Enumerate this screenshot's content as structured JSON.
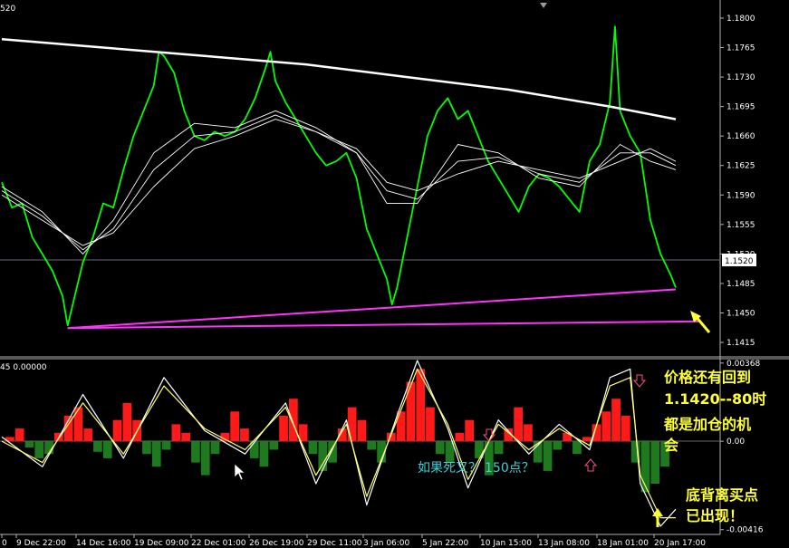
{
  "chart_data": [
    {
      "type": "line",
      "panel": "price",
      "symbol_fragment": "520",
      "y_ticks": [
        "1.1800",
        "1.1765",
        "1.1730",
        "1.1695",
        "1.1660",
        "1.1625",
        "1.1590",
        "1.1555",
        "1.1520",
        "1.1485",
        "1.1450",
        "1.1415"
      ],
      "ylim": [
        1.14,
        1.1815
      ],
      "current_price_label": "1.1520",
      "x_ticks": [
        "0",
        "9 Dec 22:00",
        "14 Dec 16:00",
        "19 Dec 09:00",
        "22 Dec 01:00",
        "26 Dec 19:00",
        "29 Dec 11:00",
        "3 Jan 06:00",
        "5 Jan 22:00",
        "10 Jan 15:00",
        "13 Jan 08:00",
        "18 Jan 01:00",
        "20 Jan 17:00"
      ],
      "series": [
        {
          "color": "#00ff00",
          "points": [
            [
              0,
              1.1605
            ],
            [
              2,
              1.1575
            ],
            [
              4,
              1.158
            ],
            [
              6,
              1.154
            ],
            [
              8,
              1.152
            ],
            [
              10,
              1.15
            ],
            [
              12,
              1.147
            ],
            [
              13,
              1.1435
            ],
            [
              14,
              1.146
            ],
            [
              16,
              1.151
            ],
            [
              18,
              1.154
            ],
            [
              20,
              1.158
            ],
            [
              22,
              1.1575
            ],
            [
              24,
              1.162
            ],
            [
              26,
              1.166
            ],
            [
              28,
              1.169
            ],
            [
              30,
              1.172
            ],
            [
              31,
              1.176
            ],
            [
              32,
              1.1755
            ],
            [
              34,
              1.1735
            ],
            [
              36,
              1.169
            ],
            [
              38,
              1.166
            ],
            [
              40,
              1.1655
            ],
            [
              42,
              1.1665
            ],
            [
              44,
              1.166
            ],
            [
              46,
              1.1665
            ],
            [
              48,
              1.168
            ],
            [
              50,
              1.1705
            ],
            [
              52,
              1.174
            ],
            [
              53,
              1.176
            ],
            [
              54,
              1.1725
            ],
            [
              56,
              1.17
            ],
            [
              58,
              1.168
            ],
            [
              60,
              1.166
            ],
            [
              62,
              1.164
            ],
            [
              64,
              1.1625
            ],
            [
              66,
              1.163
            ],
            [
              68,
              1.164
            ],
            [
              70,
              1.161
            ],
            [
              72,
              1.155
            ],
            [
              74,
              1.152
            ],
            [
              76,
              1.149
            ],
            [
              77,
              1.146
            ],
            [
              78,
              1.148
            ],
            [
              80,
              1.154
            ],
            [
              82,
              1.16
            ],
            [
              84,
              1.166
            ],
            [
              86,
              1.169
            ],
            [
              88,
              1.1705
            ],
            [
              90,
              1.168
            ],
            [
              92,
              1.169
            ],
            [
              94,
              1.166
            ],
            [
              96,
              1.163
            ],
            [
              98,
              1.161
            ],
            [
              100,
              1.159
            ],
            [
              102,
              1.157
            ],
            [
              104,
              1.16
            ],
            [
              106,
              1.1615
            ],
            [
              108,
              1.161
            ],
            [
              110,
              1.16
            ],
            [
              112,
              1.1585
            ],
            [
              114,
              1.157
            ],
            [
              116,
              1.163
            ],
            [
              118,
              1.165
            ],
            [
              120,
              1.17
            ],
            [
              121,
              1.179
            ],
            [
              122,
              1.169
            ],
            [
              124,
              1.166
            ],
            [
              126,
              1.164
            ],
            [
              128,
              1.156
            ],
            [
              130,
              1.152
            ],
            [
              132,
              1.1495
            ],
            [
              133,
              1.148
            ]
          ]
        },
        {
          "color": "#ffffff",
          "points": [
            [
              0,
              1.1775
            ],
            [
              20,
              1.1765
            ],
            [
              40,
              1.1755
            ],
            [
              60,
              1.1745
            ],
            [
              80,
              1.173
            ],
            [
              100,
              1.1715
            ],
            [
              120,
              1.1695
            ],
            [
              133,
              1.168
            ]
          ]
        },
        {
          "color": "#ffffff",
          "points": [
            [
              0,
              1.16
            ],
            [
              8,
              1.157
            ],
            [
              16,
              1.152
            ],
            [
              22,
              1.156
            ],
            [
              30,
              1.164
            ],
            [
              38,
              1.1675
            ],
            [
              46,
              1.167
            ],
            [
              54,
              1.169
            ],
            [
              62,
              1.167
            ],
            [
              70,
              1.164
            ],
            [
              76,
              1.158
            ],
            [
              82,
              1.158
            ],
            [
              90,
              1.165
            ],
            [
              98,
              1.164
            ],
            [
              106,
              1.161
            ],
            [
              114,
              1.16
            ],
            [
              122,
              1.165
            ],
            [
              128,
              1.163
            ],
            [
              133,
              1.162
            ]
          ]
        },
        {
          "color": "#ffffff",
          "points": [
            [
              0,
              1.1595
            ],
            [
              8,
              1.1565
            ],
            [
              16,
              1.1525
            ],
            [
              22,
              1.155
            ],
            [
              30,
              1.162
            ],
            [
              38,
              1.166
            ],
            [
              46,
              1.1665
            ],
            [
              54,
              1.1685
            ],
            [
              62,
              1.1665
            ],
            [
              70,
              1.164
            ],
            [
              76,
              1.1595
            ],
            [
              82,
              1.1585
            ],
            [
              90,
              1.163
            ],
            [
              98,
              1.1635
            ],
            [
              106,
              1.1615
            ],
            [
              114,
              1.1605
            ],
            [
              122,
              1.164
            ],
            [
              128,
              1.164
            ],
            [
              133,
              1.1625
            ]
          ]
        },
        {
          "color": "#ffffff",
          "points": [
            [
              0,
              1.159
            ],
            [
              8,
              1.156
            ],
            [
              16,
              1.153
            ],
            [
              22,
              1.1545
            ],
            [
              30,
              1.16
            ],
            [
              38,
              1.1645
            ],
            [
              46,
              1.166
            ],
            [
              54,
              1.168
            ],
            [
              62,
              1.1665
            ],
            [
              70,
              1.1645
            ],
            [
              76,
              1.1605
            ],
            [
              82,
              1.1595
            ],
            [
              90,
              1.1615
            ],
            [
              98,
              1.163
            ],
            [
              106,
              1.162
            ],
            [
              114,
              1.161
            ],
            [
              122,
              1.163
            ],
            [
              128,
              1.1645
            ],
            [
              133,
              1.163
            ]
          ]
        },
        {
          "color": "#ff33ff",
          "points": [
            [
              13,
              1.1432
            ],
            [
              133,
              1.1478
            ]
          ]
        },
        {
          "color": "#ff33ff",
          "points": [
            [
              13,
              1.1432
            ],
            [
              138,
              1.144
            ]
          ]
        }
      ]
    },
    {
      "type": "bar",
      "panel": "indicator",
      "header": "45 0.00000",
      "y_ticks": [
        "0.00368",
        "0.00",
        "-0.00416"
      ],
      "ylim": [
        -0.0043,
        0.0038
      ],
      "histogram": [
        0.0002,
        0.0006,
        -0.0003,
        -0.0008,
        -0.0006,
        0.0004,
        0.0012,
        0.0016,
        0.0006,
        -0.0005,
        -0.0008,
        0.001,
        0.0018,
        0.001,
        -0.0006,
        -0.0012,
        -0.0004,
        0.0008,
        0.0004,
        -0.001,
        -0.0016,
        -0.0006,
        0.0004,
        0.0014,
        0.0006,
        -0.0008,
        -0.0012,
        -0.0004,
        0.0012,
        0.002,
        0.0008,
        -0.0006,
        -0.0014,
        -0.001,
        0.0006,
        0.0016,
        0.001,
        -0.0004,
        -0.001,
        0.0004,
        0.0014,
        0.0028,
        0.0034,
        0.0016,
        -0.0006,
        -0.001,
        0.0004,
        0.001,
        -0.0008,
        -0.0016,
        -0.0006,
        0.0006,
        0.0016,
        0.0008,
        -0.001,
        -0.0014,
        -0.0004,
        0.0004,
        -0.0006,
        0.0002,
        0.0008,
        0.0014,
        0.002,
        0.0012,
        -0.001,
        -0.0024,
        -0.002,
        -0.0012
      ],
      "lines": [
        {
          "color": "#ffffff",
          "points": [
            [
              0,
              0.0002
            ],
            [
              8,
              -0.0012
            ],
            [
              16,
              0.0022
            ],
            [
              24,
              -0.0008
            ],
            [
              32,
              0.003
            ],
            [
              40,
              0.0005
            ],
            [
              48,
              -0.0006
            ],
            [
              56,
              0.0018
            ],
            [
              62,
              -0.002
            ],
            [
              68,
              0.001
            ],
            [
              72,
              -0.003
            ],
            [
              78,
              0.0012
            ],
            [
              82,
              0.0038
            ],
            [
              88,
              0.0006
            ],
            [
              92,
              -0.0022
            ],
            [
              98,
              0.001
            ],
            [
              104,
              -0.0006
            ],
            [
              110,
              0.0008
            ],
            [
              116,
              -0.0004
            ],
            [
              120,
              0.003
            ],
            [
              124,
              0.0034
            ],
            [
              126,
              -0.002
            ],
            [
              130,
              -0.004
            ],
            [
              133,
              -0.0032
            ]
          ]
        },
        {
          "color": "#ffff66",
          "points": [
            [
              0,
              0.0
            ],
            [
              8,
              -0.001
            ],
            [
              16,
              0.0018
            ],
            [
              24,
              -0.0006
            ],
            [
              32,
              0.0026
            ],
            [
              40,
              0.0006
            ],
            [
              48,
              -0.0004
            ],
            [
              56,
              0.0016
            ],
            [
              62,
              -0.0016
            ],
            [
              68,
              0.0008
            ],
            [
              72,
              -0.0026
            ],
            [
              78,
              0.001
            ],
            [
              82,
              0.0034
            ],
            [
              88,
              0.0008
            ],
            [
              92,
              -0.0018
            ],
            [
              98,
              0.0008
            ],
            [
              104,
              -0.0004
            ],
            [
              110,
              0.0006
            ],
            [
              116,
              -0.0002
            ],
            [
              120,
              0.0026
            ],
            [
              124,
              0.003
            ],
            [
              126,
              -0.0016
            ],
            [
              130,
              -0.0036
            ],
            [
              133,
              -0.0036
            ]
          ]
        }
      ]
    }
  ],
  "annotations": {
    "main_line1": "价格还有回到",
    "main_line2_a": "1.1420--80",
    "main_line2_b": "时",
    "main_line3": "都是加仓的机",
    "main_line4": "会",
    "death_cross_a": "如果死叉？",
    "death_cross_b": "150点？",
    "bottom_divergence_line1": "底背离买点",
    "bottom_divergence_line2": "已出现！"
  }
}
